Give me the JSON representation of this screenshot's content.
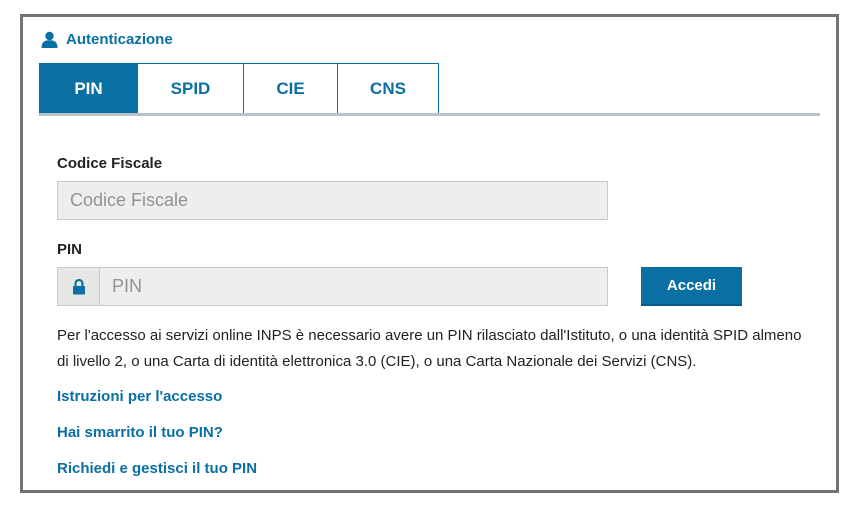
{
  "header": {
    "title": "Autenticazione",
    "icon": "user-icon"
  },
  "tabs": [
    {
      "label": "PIN",
      "active": true
    },
    {
      "label": "SPID",
      "active": false
    },
    {
      "label": "CIE",
      "active": false
    },
    {
      "label": "CNS",
      "active": false
    }
  ],
  "form": {
    "codice_fiscale_label": "Codice Fiscale",
    "codice_fiscale_placeholder": "Codice Fiscale",
    "pin_label": "PIN",
    "pin_placeholder": "PIN",
    "pin_icon": "lock-icon",
    "submit_label": "Accedi"
  },
  "info_text": "Per l'accesso ai servizi online INPS è necessario avere un PIN rilasciato dall'Istituto, o una identità SPID almeno di livello 2, o una Carta di identità elettronica 3.0 (CIE), o una Carta Nazionale dei Servizi (CNS).",
  "links": [
    "Istruzioni per l'accesso",
    "Hai smarrito il tuo PIN?",
    "Richiedi e gestisci il tuo PIN"
  ],
  "colors": {
    "accent": "#0a6fa3",
    "border": "#707478",
    "input_bg": "#eeeeec"
  }
}
